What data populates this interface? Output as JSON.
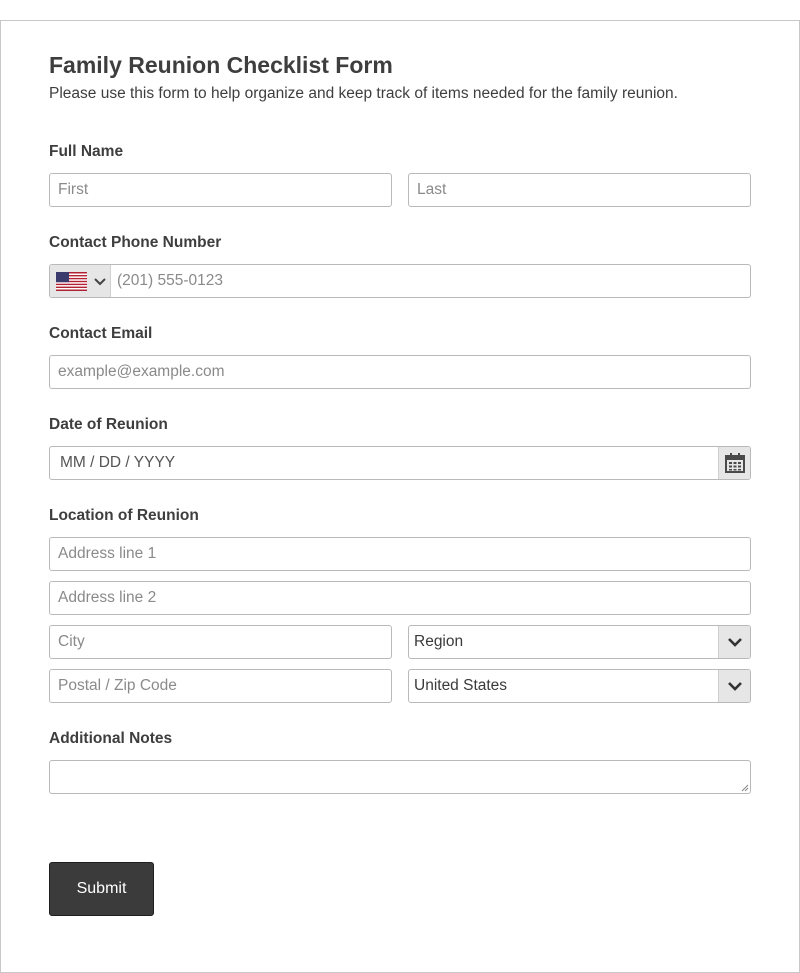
{
  "form": {
    "title": "Family Reunion Checklist Form",
    "subtitle": "Please use this form to help organize and keep track of items needed for the family reunion.",
    "full_name": {
      "label": "Full Name",
      "first_placeholder": "First",
      "last_placeholder": "Last"
    },
    "phone": {
      "label": "Contact Phone Number",
      "placeholder": "(201) 555-0123",
      "country_flag": "us-flag-icon"
    },
    "email": {
      "label": "Contact Email",
      "placeholder": "example@example.com"
    },
    "date": {
      "label": "Date of Reunion",
      "placeholder": "MM / DD / YYYY",
      "icon": "calendar-icon"
    },
    "location": {
      "label": "Location of Reunion",
      "address1_placeholder": "Address line 1",
      "address2_placeholder": "Address line 2",
      "city_placeholder": "City",
      "region_value": "Region",
      "postal_placeholder": "Postal / Zip Code",
      "country_value": "United States"
    },
    "notes": {
      "label": "Additional Notes",
      "value": ""
    },
    "submit_label": "Submit"
  },
  "colors": {
    "submit_bg": "#3b3b3b",
    "field_border": "#b9b9b9",
    "addon_bg": "#e6e6e6",
    "text": "#3e3e3e",
    "placeholder": "#8a8a8a"
  }
}
